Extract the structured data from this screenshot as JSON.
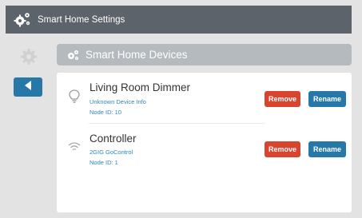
{
  "window": {
    "title": "Smart Home Settings",
    "icon": "smart-home-gears-icon"
  },
  "sidebar": {
    "gear_icon": "gear-icon",
    "back_icon": "triangle-left-icon"
  },
  "section": {
    "title": "Smart Home Devices",
    "icon": "gears-icon"
  },
  "devices": [
    {
      "name": "Living Room Dimmer",
      "info": "Unknown Device Info",
      "node": "Node ID: 10",
      "icon": "lightbulb-icon",
      "remove_label": "Remove",
      "rename_label": "Rename"
    },
    {
      "name": "Controller",
      "info": "2GIG GoControl",
      "node": "Node ID: 1",
      "icon": "wifi-icon",
      "remove_label": "Remove",
      "rename_label": "Rename"
    }
  ],
  "colors": {
    "titlebar": "#5c636a",
    "accent_blue": "#2578a8",
    "remove_red": "#d9442e",
    "link_blue": "#2e86c1",
    "header_gray": "#b5babe"
  }
}
